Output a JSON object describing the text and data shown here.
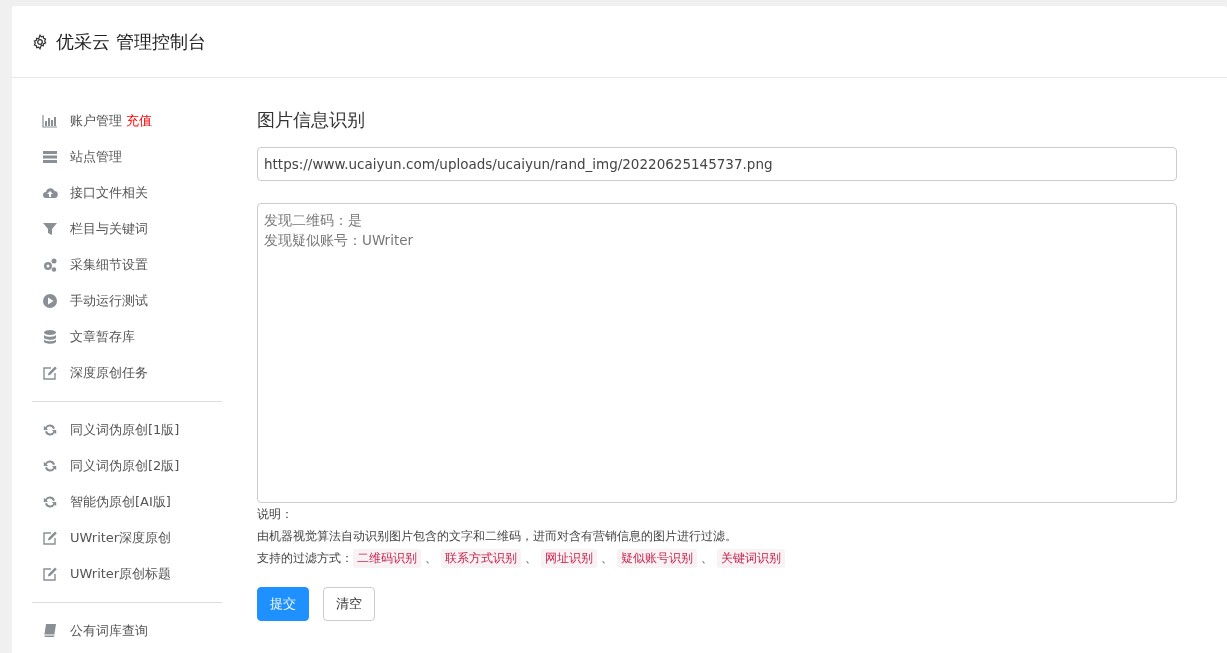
{
  "header": {
    "title": "优采云 管理控制台"
  },
  "sidebar": {
    "groups": [
      [
        {
          "label": "账户管理",
          "badge": "充值"
        },
        {
          "label": "站点管理"
        },
        {
          "label": "接口文件相关"
        },
        {
          "label": "栏目与关键词"
        },
        {
          "label": "采集细节设置"
        },
        {
          "label": "手动运行测试"
        },
        {
          "label": "文章暂存库"
        },
        {
          "label": "深度原创任务"
        }
      ],
      [
        {
          "label": "同义词伪原创[1版]"
        },
        {
          "label": "同义词伪原创[2版]"
        },
        {
          "label": "智能伪原创[AI版]"
        },
        {
          "label": "UWriter深度原创"
        },
        {
          "label": "UWriter原创标题"
        }
      ],
      [
        {
          "label": "公有词库查询"
        }
      ]
    ]
  },
  "main": {
    "heading": "图片信息识别",
    "url_field": {
      "value": "https://www.ucaiyun.com/uploads/ucaiyun/rand_img/20220625145737.png"
    },
    "result_box": {
      "lines": [
        "发现二维码：是",
        "发现疑似账号：UWriter"
      ]
    },
    "notes": {
      "title": "说明：",
      "description": "由机器视觉算法自动识别图片包含的文字和二维码，进而对含有营销信息的图片进行过滤。",
      "methods_label": "支持的过滤方式：",
      "methods": [
        "二维码识别",
        "联系方式识别",
        "网址识别",
        "疑似账号识别",
        "关键词识别"
      ],
      "separator": "、"
    },
    "buttons": [
      {
        "label": "提交",
        "kind": "primary"
      },
      {
        "label": "清空",
        "kind": "default"
      }
    ]
  }
}
